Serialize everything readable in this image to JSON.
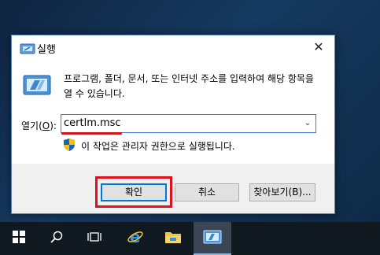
{
  "dialog": {
    "title": "실행",
    "close_symbol": "✕",
    "description": "프로그램, 폴더, 문서, 또는 인터넷 주소를 입력하여 해당 항목을 열 수 있습니다.",
    "open_label_prefix": "열기(",
    "open_label_accel": "O",
    "open_label_suffix": "):",
    "command_value": "certlm.msc",
    "admin_note": "이 작업은 관리자 권한으로 실행됩니다.",
    "buttons": {
      "ok": "확인",
      "cancel": "취소",
      "browse": "찾아보기(B)..."
    }
  },
  "taskbar": {
    "items": [
      "windows-start-icon",
      "search-icon",
      "task-view-icon",
      "internet-explorer-icon",
      "file-explorer-icon",
      "run-dialog-icon"
    ]
  },
  "colors": {
    "accent": "#0078d7",
    "highlight_red": "#e0101c",
    "taskbar": "#101820"
  }
}
